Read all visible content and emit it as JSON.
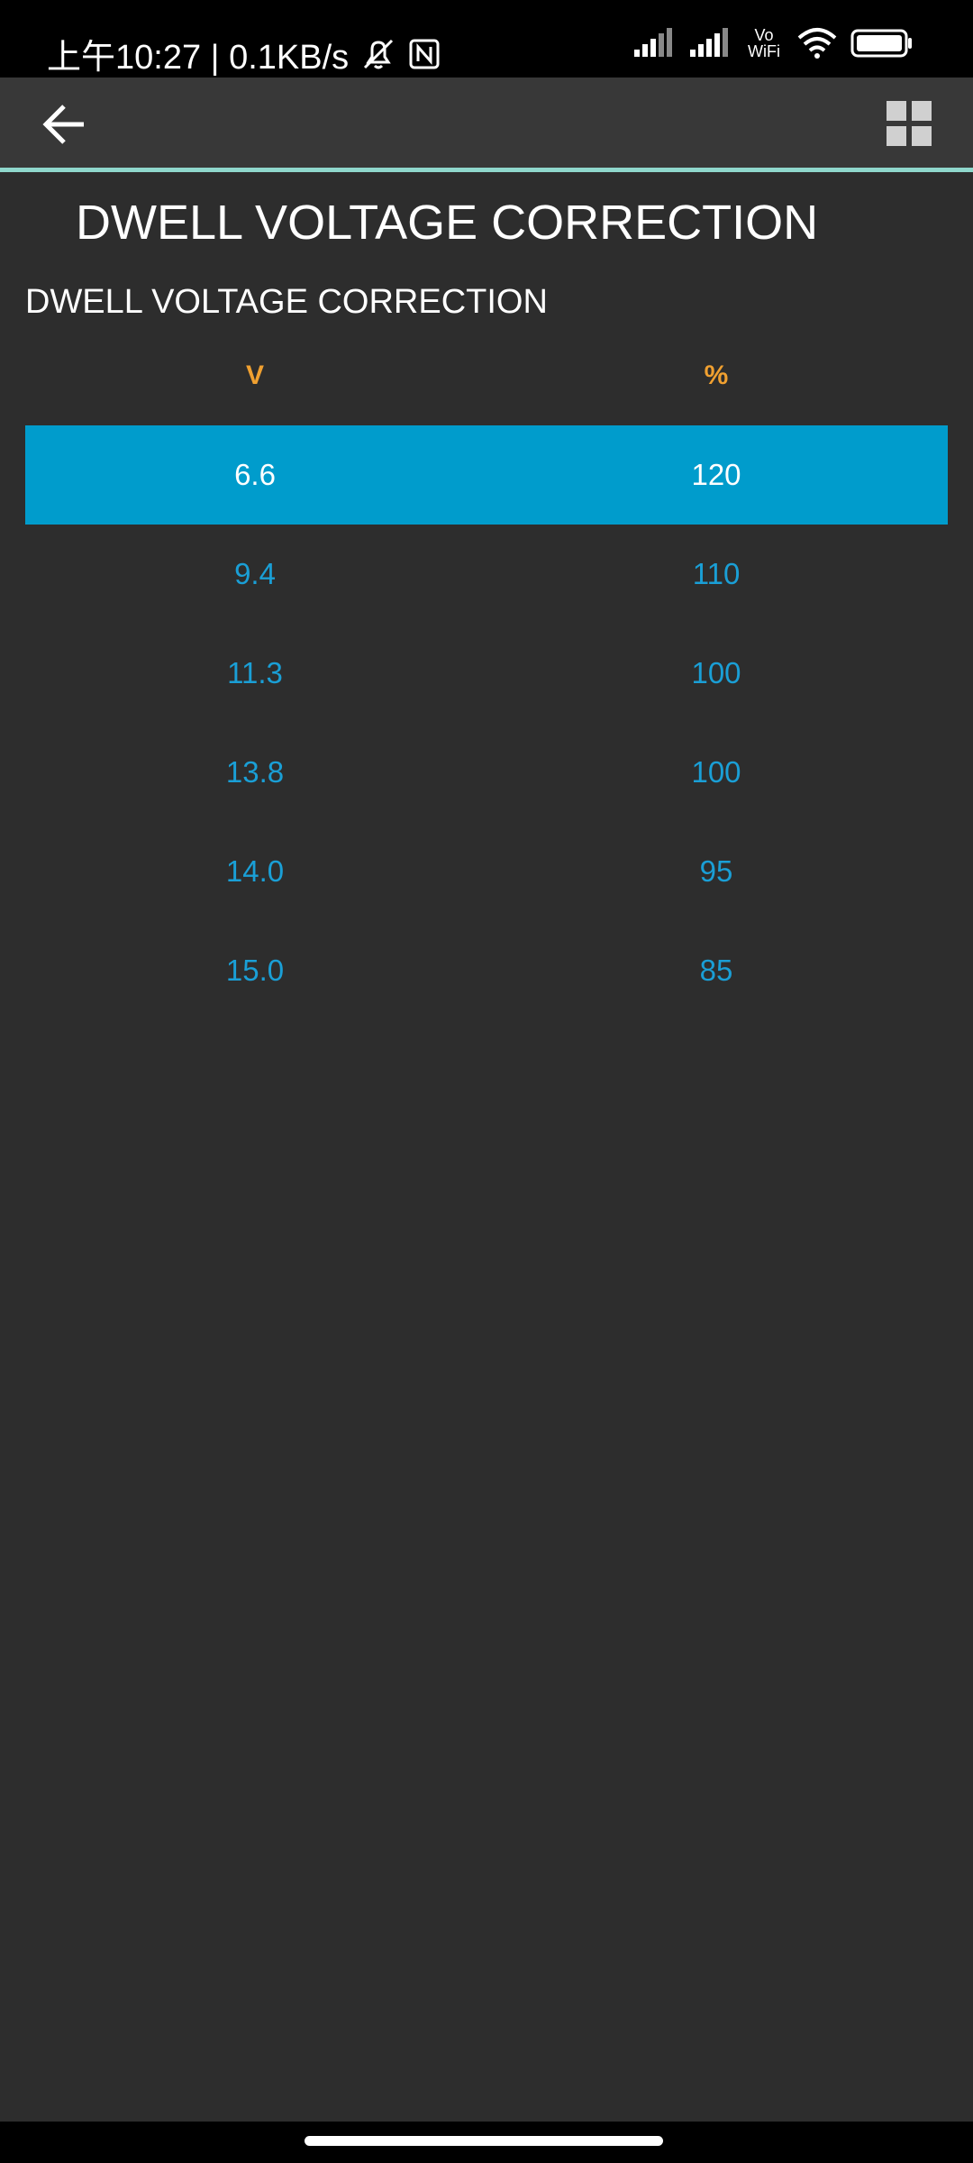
{
  "status_bar": {
    "left_text": "上午10:27 | 0.1KB/s",
    "wifi_label_top": "Vo",
    "wifi_label_bottom": "WiFi"
  },
  "toolbar": {
    "back_icon": "arrow-left-icon",
    "grid_icon": "grid-icon"
  },
  "page": {
    "title": "DWELL VOLTAGE CORRECTION",
    "section_title": "DWELL VOLTAGE CORRECTION"
  },
  "table": {
    "headers": [
      "V",
      "%"
    ],
    "rows": [
      {
        "v": "6.6",
        "p": "120",
        "selected": true
      },
      {
        "v": "9.4",
        "p": "110",
        "selected": false
      },
      {
        "v": "11.3",
        "p": "100",
        "selected": false
      },
      {
        "v": "13.8",
        "p": "100",
        "selected": false
      },
      {
        "v": "14.0",
        "p": "95",
        "selected": false
      },
      {
        "v": "15.0",
        "p": "85",
        "selected": false
      }
    ]
  },
  "colors": {
    "accent": "#8fd7cc",
    "selected_row": "#009ccc",
    "value_text": "#1a9fd6",
    "header_text": "#f0a030",
    "background": "#2d2d2d"
  }
}
